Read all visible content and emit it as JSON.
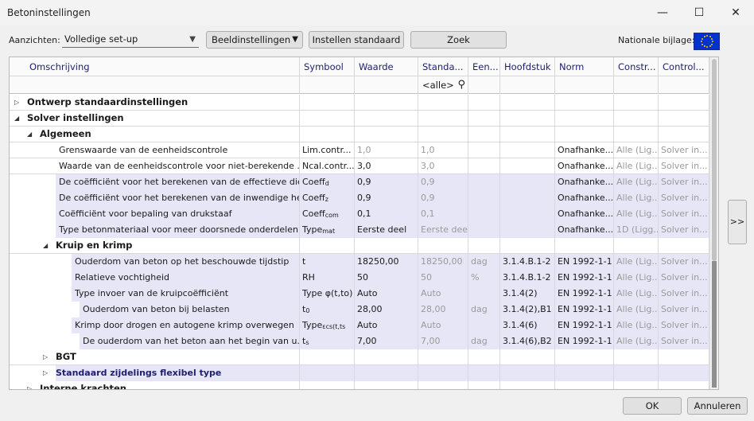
{
  "window": {
    "title": "Betoninstellingen",
    "minimize": "—",
    "maximize": "☐",
    "close": "✕"
  },
  "toolbar": {
    "views_label": "Aanzichten:",
    "views_value": "Volledige set-up",
    "display_settings": "Beeldinstellingen",
    "set_standard": "Instellen standaard",
    "search": "Zoek",
    "national_annex_label": "Nationale bijlage:"
  },
  "columns": [
    "Omschrijving",
    "Symbool",
    "Waarde",
    "Standa...",
    "Een...",
    "Hoofdstuk",
    "Norm",
    "Constr...",
    "Control..."
  ],
  "filter_all": "<alle>",
  "rows": [
    {
      "level": 0,
      "expand": "collapsed",
      "desc": "Ontwerp standaardinstellingen",
      "bold": true
    },
    {
      "level": 0,
      "expand": "expanded",
      "desc": "Solver instellingen",
      "bold": true
    },
    {
      "level": 1,
      "expand": "expanded",
      "desc": "Algemeen",
      "bold": true
    },
    {
      "level": 2,
      "desc": "Grenswaarde van de eenheidscontrole",
      "sym": "Lim.contr...",
      "val": "1,0",
      "valGray": true,
      "std": "1,0",
      "norm": "Onafhanke...",
      "constr": "Alle (Lig...",
      "control": "Solver in..."
    },
    {
      "level": 2,
      "desc": "Waarde van de eenheidscontrole voor niet-berekende ...",
      "sym": "Ncal.contr...",
      "val": "3,0",
      "std": "3,0",
      "norm": "Onafhanke...",
      "constr": "Alle (Lig...",
      "control": "Solver in..."
    },
    {
      "level": 2,
      "hl": true,
      "desc": "De coëfficiënt voor het berekenen van de effectieve die...",
      "sym": "Coeff",
      "symSub": "d",
      "val": "0,9",
      "std": "0,9",
      "norm": "Onafhanke...",
      "constr": "Alle (Lig...",
      "control": "Solver in..."
    },
    {
      "level": 2,
      "hl": true,
      "desc": "De coëfficiënt voor het berekenen van de inwendige he...",
      "sym": "Coeff",
      "symSub": "z",
      "val": "0,9",
      "std": "0,9",
      "norm": "Onafhanke...",
      "constr": "Alle (Lig...",
      "control": "Solver in..."
    },
    {
      "level": 2,
      "hl": true,
      "desc": "Coëfficiënt voor bepaling van drukstaaf",
      "sym": "Coeff",
      "symSub": "com",
      "val": "0,1",
      "std": "0,1",
      "norm": "Onafhanke...",
      "constr": "Alle (Lig...",
      "control": "Solver in..."
    },
    {
      "level": 2,
      "hl": true,
      "desc": "Type betonmateriaal voor meer doorsnede onderdelen",
      "sym": "Type",
      "symSub": "mat",
      "val": "Eerste deel",
      "std": "Eerste deel",
      "norm": "Onafhanke...",
      "constr": "1D (Ligg...",
      "control": "Solver in..."
    },
    {
      "level": 2,
      "expand": "expanded",
      "desc": "Kruip en krimp",
      "bold": true
    },
    {
      "level": 3,
      "hl": true,
      "desc": "Ouderdom van beton op het beschouwde tijdstip",
      "sym": "t",
      "val": "18250,00",
      "std": "18250,00",
      "unit": "dag",
      "chap": "3.1.4.B.1-2",
      "norm": "EN 1992-1-1",
      "constr": "Alle (Lig...",
      "control": "Solver in..."
    },
    {
      "level": 3,
      "hl": true,
      "desc": "Relatieve vochtigheid",
      "sym": "RH",
      "val": "50",
      "std": "50",
      "unit": "%",
      "chap": "3.1.4.B.1-2",
      "norm": "EN 1992-1-1",
      "constr": "Alle (Lig...",
      "control": "Solver in..."
    },
    {
      "level": 3,
      "hl": true,
      "desc": "Type invoer van de kruipcoëfficiënt",
      "sym": "Type φ(t,to)",
      "val": "Auto",
      "std": "Auto",
      "chap": "3.1.4(2)",
      "norm": "EN 1992-1-1",
      "constr": "Alle (Lig...",
      "control": "Solver in..."
    },
    {
      "level": 4,
      "hl": true,
      "desc": "Ouderdom van beton bij belasten",
      "sym": "t",
      "symSub": "0",
      "val": "28,00",
      "std": "28,00",
      "unit": "dag",
      "chap": "3.1.4(2),B1",
      "norm": "EN 1992-1-1",
      "constr": "Alle (Lig...",
      "control": "Solver in..."
    },
    {
      "level": 3,
      "hl": true,
      "desc": "Krimp door drogen en autogene krimp overwegen",
      "sym": "Type",
      "symSub": "εcs(t,ts",
      "val": "Auto",
      "std": "Auto",
      "chap": "3.1.4(6)",
      "norm": "EN 1992-1-1",
      "constr": "Alle (Lig...",
      "control": "Solver in..."
    },
    {
      "level": 4,
      "hl": true,
      "desc": "De ouderdom van het beton aan het begin van u...",
      "sym": "t",
      "symSub": "s",
      "val": "7,00",
      "std": "7,00",
      "unit": "dag",
      "chap": "3.1.4(6),B2",
      "norm": "EN 1992-1-1",
      "constr": "Alle (Lig...",
      "control": "Solver in..."
    },
    {
      "level": 2,
      "expand": "collapsed",
      "desc": "BGT",
      "bold": true
    },
    {
      "level": 2,
      "expand": "collapsed",
      "desc": "Standaard zijdelings flexibel type",
      "navy": true,
      "hl2": true
    },
    {
      "level": 1,
      "expand": "collapsed",
      "desc": "Interne krachten",
      "bold": true
    }
  ],
  "side_button": ">>",
  "footer": {
    "ok": "OK",
    "cancel": "Annuleren"
  },
  "colors": {
    "flag_blue": "#0033cc",
    "highlight_row": "#e6e6f7",
    "header_text": "#1e1e6e"
  }
}
